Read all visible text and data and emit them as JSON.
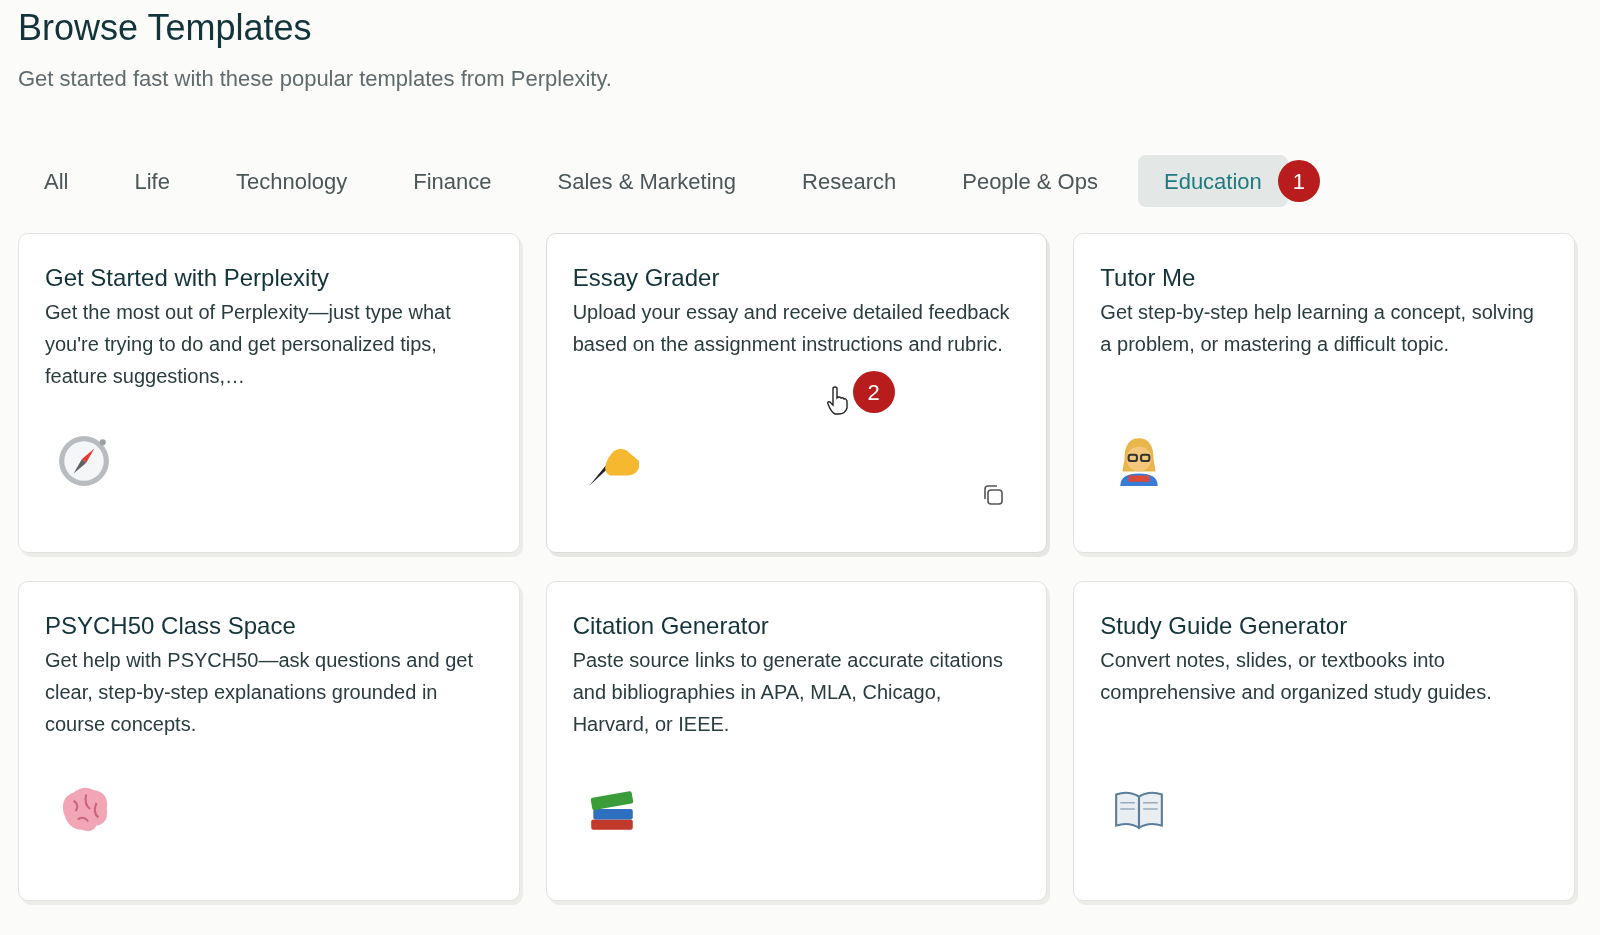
{
  "title": "Browse Templates",
  "subtitle": "Get started fast with these popular templates from Perplexity.",
  "tabs": [
    {
      "label": "All",
      "selected": false
    },
    {
      "label": "Life",
      "selected": false
    },
    {
      "label": "Technology",
      "selected": false
    },
    {
      "label": "Finance",
      "selected": false
    },
    {
      "label": "Sales & Marketing",
      "selected": false
    },
    {
      "label": "Research",
      "selected": false
    },
    {
      "label": "People & Ops",
      "selected": false
    },
    {
      "label": "Education",
      "selected": true,
      "marker": "1"
    }
  ],
  "cards": [
    {
      "title": "Get Started with Perplexity",
      "description": "Get the most out of Perplexity—just type what you're trying to do and get personalized tips, feature suggestions,…",
      "hovered": false
    },
    {
      "title": "Essay Grader",
      "description": "Upload your essay and receive detailed feedback based on the assignment instructions and rubric.",
      "hovered": true,
      "marker": "2"
    },
    {
      "title": "Tutor Me",
      "description": "Get step-by-step help learning a concept, solving a problem, or mastering a difficult topic.",
      "hovered": false
    },
    {
      "title": "PSYCH50 Class Space",
      "description": "Get help with PSYCH50—ask questions and get clear, step-by-step explanations grounded in course concepts.",
      "hovered": false
    },
    {
      "title": "Citation Generator",
      "description": "Paste source links to generate accurate citations and bibliographies in APA, MLA, Chicago, Harvard, or IEEE.",
      "hovered": false
    },
    {
      "title": "Study Guide Generator",
      "description": "Convert notes, slides, or textbooks into comprehensive and organized study guides.",
      "hovered": false
    }
  ]
}
